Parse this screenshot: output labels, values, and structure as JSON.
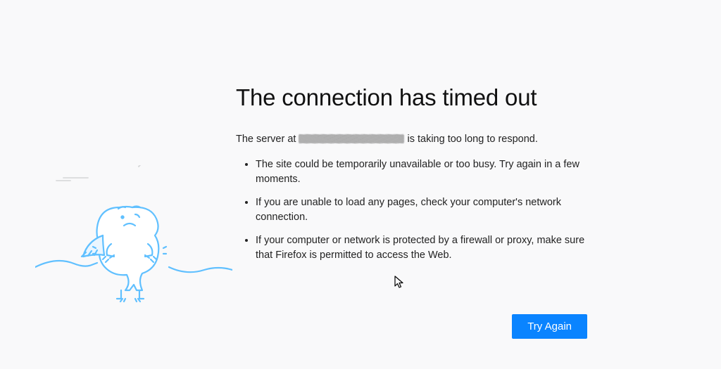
{
  "error": {
    "title": "The connection has timed out",
    "subtitle_prefix": "The server at ",
    "subtitle_suffix": " is taking too long to respond.",
    "server_hostname_redacted": true,
    "suggestions": [
      "The site could be temporarily unavailable or too busy. Try again in a few moments.",
      "If you are unable to load any pages, check your computer's network connection.",
      "If your computer or network is protected by a firewall or proxy, make sure that Firefox is permitted to access the Web."
    ]
  },
  "actions": {
    "try_again_label": "Try Again"
  },
  "illustration": {
    "name": "firefox-dino-unplugged"
  },
  "colors": {
    "background": "#f9f9fa",
    "primary_button": "#0a84ff",
    "illustration_stroke": "#37adff"
  }
}
